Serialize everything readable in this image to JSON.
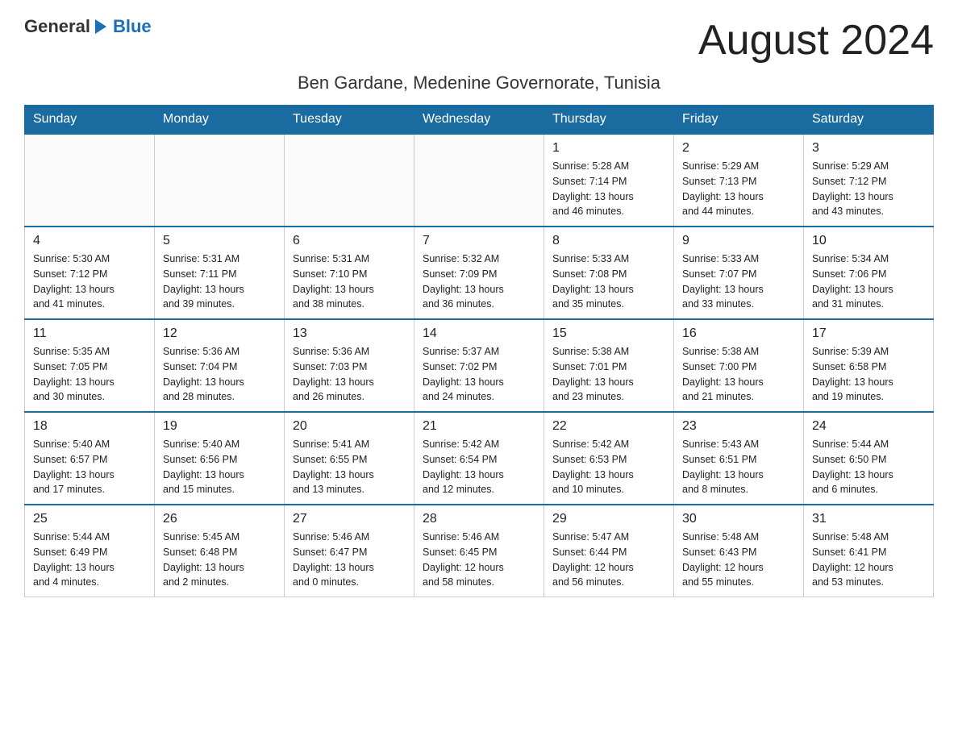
{
  "logo": {
    "text_general": "General",
    "text_blue": "Blue"
  },
  "header": {
    "month_title": "August 2024",
    "location": "Ben Gardane, Medenine Governorate, Tunisia"
  },
  "weekdays": [
    "Sunday",
    "Monday",
    "Tuesday",
    "Wednesday",
    "Thursday",
    "Friday",
    "Saturday"
  ],
  "weeks": [
    [
      {
        "day": "",
        "info": ""
      },
      {
        "day": "",
        "info": ""
      },
      {
        "day": "",
        "info": ""
      },
      {
        "day": "",
        "info": ""
      },
      {
        "day": "1",
        "info": "Sunrise: 5:28 AM\nSunset: 7:14 PM\nDaylight: 13 hours\nand 46 minutes."
      },
      {
        "day": "2",
        "info": "Sunrise: 5:29 AM\nSunset: 7:13 PM\nDaylight: 13 hours\nand 44 minutes."
      },
      {
        "day": "3",
        "info": "Sunrise: 5:29 AM\nSunset: 7:12 PM\nDaylight: 13 hours\nand 43 minutes."
      }
    ],
    [
      {
        "day": "4",
        "info": "Sunrise: 5:30 AM\nSunset: 7:12 PM\nDaylight: 13 hours\nand 41 minutes."
      },
      {
        "day": "5",
        "info": "Sunrise: 5:31 AM\nSunset: 7:11 PM\nDaylight: 13 hours\nand 39 minutes."
      },
      {
        "day": "6",
        "info": "Sunrise: 5:31 AM\nSunset: 7:10 PM\nDaylight: 13 hours\nand 38 minutes."
      },
      {
        "day": "7",
        "info": "Sunrise: 5:32 AM\nSunset: 7:09 PM\nDaylight: 13 hours\nand 36 minutes."
      },
      {
        "day": "8",
        "info": "Sunrise: 5:33 AM\nSunset: 7:08 PM\nDaylight: 13 hours\nand 35 minutes."
      },
      {
        "day": "9",
        "info": "Sunrise: 5:33 AM\nSunset: 7:07 PM\nDaylight: 13 hours\nand 33 minutes."
      },
      {
        "day": "10",
        "info": "Sunrise: 5:34 AM\nSunset: 7:06 PM\nDaylight: 13 hours\nand 31 minutes."
      }
    ],
    [
      {
        "day": "11",
        "info": "Sunrise: 5:35 AM\nSunset: 7:05 PM\nDaylight: 13 hours\nand 30 minutes."
      },
      {
        "day": "12",
        "info": "Sunrise: 5:36 AM\nSunset: 7:04 PM\nDaylight: 13 hours\nand 28 minutes."
      },
      {
        "day": "13",
        "info": "Sunrise: 5:36 AM\nSunset: 7:03 PM\nDaylight: 13 hours\nand 26 minutes."
      },
      {
        "day": "14",
        "info": "Sunrise: 5:37 AM\nSunset: 7:02 PM\nDaylight: 13 hours\nand 24 minutes."
      },
      {
        "day": "15",
        "info": "Sunrise: 5:38 AM\nSunset: 7:01 PM\nDaylight: 13 hours\nand 23 minutes."
      },
      {
        "day": "16",
        "info": "Sunrise: 5:38 AM\nSunset: 7:00 PM\nDaylight: 13 hours\nand 21 minutes."
      },
      {
        "day": "17",
        "info": "Sunrise: 5:39 AM\nSunset: 6:58 PM\nDaylight: 13 hours\nand 19 minutes."
      }
    ],
    [
      {
        "day": "18",
        "info": "Sunrise: 5:40 AM\nSunset: 6:57 PM\nDaylight: 13 hours\nand 17 minutes."
      },
      {
        "day": "19",
        "info": "Sunrise: 5:40 AM\nSunset: 6:56 PM\nDaylight: 13 hours\nand 15 minutes."
      },
      {
        "day": "20",
        "info": "Sunrise: 5:41 AM\nSunset: 6:55 PM\nDaylight: 13 hours\nand 13 minutes."
      },
      {
        "day": "21",
        "info": "Sunrise: 5:42 AM\nSunset: 6:54 PM\nDaylight: 13 hours\nand 12 minutes."
      },
      {
        "day": "22",
        "info": "Sunrise: 5:42 AM\nSunset: 6:53 PM\nDaylight: 13 hours\nand 10 minutes."
      },
      {
        "day": "23",
        "info": "Sunrise: 5:43 AM\nSunset: 6:51 PM\nDaylight: 13 hours\nand 8 minutes."
      },
      {
        "day": "24",
        "info": "Sunrise: 5:44 AM\nSunset: 6:50 PM\nDaylight: 13 hours\nand 6 minutes."
      }
    ],
    [
      {
        "day": "25",
        "info": "Sunrise: 5:44 AM\nSunset: 6:49 PM\nDaylight: 13 hours\nand 4 minutes."
      },
      {
        "day": "26",
        "info": "Sunrise: 5:45 AM\nSunset: 6:48 PM\nDaylight: 13 hours\nand 2 minutes."
      },
      {
        "day": "27",
        "info": "Sunrise: 5:46 AM\nSunset: 6:47 PM\nDaylight: 13 hours\nand 0 minutes."
      },
      {
        "day": "28",
        "info": "Sunrise: 5:46 AM\nSunset: 6:45 PM\nDaylight: 12 hours\nand 58 minutes."
      },
      {
        "day": "29",
        "info": "Sunrise: 5:47 AM\nSunset: 6:44 PM\nDaylight: 12 hours\nand 56 minutes."
      },
      {
        "day": "30",
        "info": "Sunrise: 5:48 AM\nSunset: 6:43 PM\nDaylight: 12 hours\nand 55 minutes."
      },
      {
        "day": "31",
        "info": "Sunrise: 5:48 AM\nSunset: 6:41 PM\nDaylight: 12 hours\nand 53 minutes."
      }
    ]
  ]
}
